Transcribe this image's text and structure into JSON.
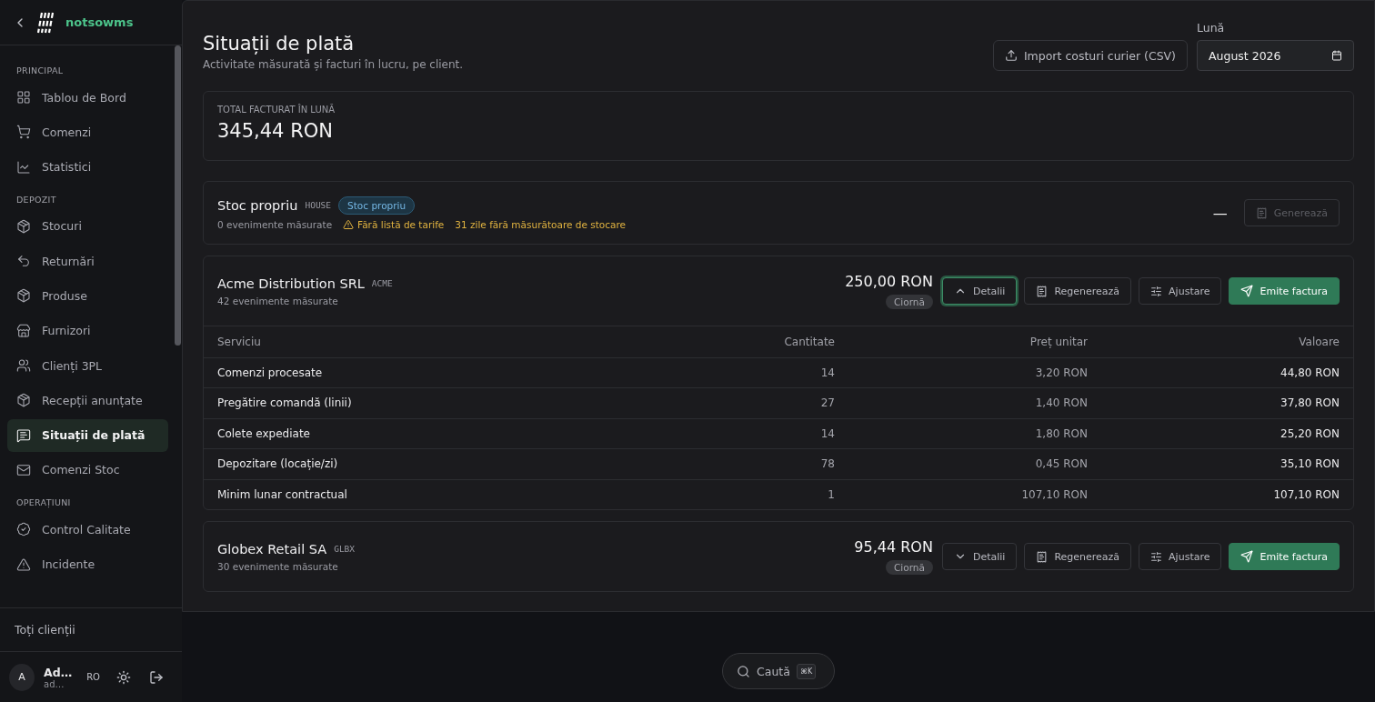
{
  "sidebar": {
    "logo": "notsowms",
    "sections": [
      {
        "title": "PRINCIPAL",
        "items": [
          {
            "label": "Tablou de Bord",
            "selected": false
          },
          {
            "label": "Comenzi",
            "selected": false
          },
          {
            "label": "Statistici",
            "selected": false
          }
        ]
      },
      {
        "title": "DEPOZIT",
        "items": [
          {
            "label": "Stocuri",
            "selected": false
          },
          {
            "label": "Returnări",
            "selected": false
          },
          {
            "label": "Produse",
            "selected": false
          },
          {
            "label": "Furnizori",
            "selected": false
          },
          {
            "label": "Clienți 3PL",
            "selected": false
          },
          {
            "label": "Recepții anunțate",
            "selected": false
          },
          {
            "label": "Situații de plată",
            "selected": true
          },
          {
            "label": "Comenzi Stoc",
            "selected": false
          }
        ]
      },
      {
        "title": "OPERAȚIUNI",
        "items": [
          {
            "label": "Control Calitate",
            "selected": false
          },
          {
            "label": "Incidente",
            "selected": false
          }
        ]
      }
    ],
    "footer_link": "Toți clienții",
    "user": {
      "initial": "A",
      "name": "Ad…",
      "email": "ad…"
    },
    "language": "RO"
  },
  "header": {
    "title": "Situații de plată",
    "subtitle": "Activitate măsurată și facturi în lucru, pe client.",
    "import_button": "Import costuri curier (CSV)",
    "month_label": "Lună",
    "month_value": "August 2026"
  },
  "total": {
    "label": "TOTAL FACTURAT ÎN LUNĂ",
    "value": "345,44 RON"
  },
  "clients": [
    {
      "kind": "house",
      "name": "Stoc propriu",
      "code": "HOUSE",
      "badge": "Stoc propriu",
      "events": "0 evenimente măsurate",
      "warnings": [
        "Fără listă de tarife",
        "31 zile fără măsurătoare de stocare"
      ],
      "amount": "—",
      "generate_button": {
        "label": "Generează",
        "disabled": true
      }
    },
    {
      "kind": "client",
      "name": "Acme Distribution SRL",
      "code": "ACME",
      "events": "42 evenimente măsurate",
      "amount": "250,00 RON",
      "status": "Ciornă",
      "expanded": true,
      "focused": true,
      "buttons": {
        "details": "Detalii",
        "regenerate": "Regenerează",
        "adjust": "Ajustare",
        "issue": "Emite factura"
      },
      "table": {
        "columns": [
          "Serviciu",
          "Cantitate",
          "Preț unitar",
          "Valoare"
        ],
        "rows": [
          [
            "Comenzi procesate",
            "14",
            "3,20 RON",
            "44,80 RON"
          ],
          [
            "Pregătire comandă (linii)",
            "27",
            "1,40 RON",
            "37,80 RON"
          ],
          [
            "Colete expediate",
            "14",
            "1,80 RON",
            "25,20 RON"
          ],
          [
            "Depozitare (locație/zi)",
            "78",
            "0,45 RON",
            "35,10 RON"
          ],
          [
            "Minim lunar contractual",
            "1",
            "107,10 RON",
            "107,10 RON"
          ]
        ]
      }
    },
    {
      "kind": "client",
      "name": "Globex Retail SA",
      "code": "GLBX",
      "events": "30 evenimente măsurate",
      "amount": "95,44 RON",
      "status": "Ciornă",
      "expanded": false,
      "focused": false,
      "buttons": {
        "details": "Detalii",
        "regenerate": "Regenerează",
        "adjust": "Ajustare",
        "issue": "Emite factura"
      }
    }
  ],
  "search": {
    "placeholder": "Caută",
    "shortcut": "⌘K"
  }
}
